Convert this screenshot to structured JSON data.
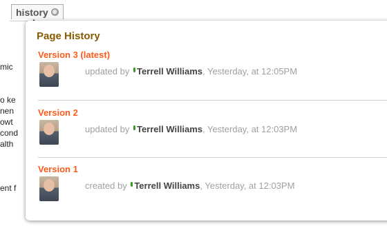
{
  "tab": {
    "label": "history",
    "close_glyph": "⊗"
  },
  "background_fragments": [
    "mic",
    "o ke",
    "nen",
    "owt",
    "cond",
    "alth",
    "ent f"
  ],
  "popup": {
    "title": "Page History",
    "versions": [
      {
        "label": "Version 3 (latest)",
        "action": "updated by",
        "user": "Terrell Williams",
        "time": ", Yesterday, at 12:05PM"
      },
      {
        "label": "Version 2",
        "action": "updated by",
        "user": "Terrell Williams",
        "time": ", Yesterday, at 12:03PM"
      },
      {
        "label": "Version 1",
        "action": "created by",
        "user": "Terrell Williams",
        "time": ", Yesterday, at 12:03PM"
      }
    ]
  },
  "colors": {
    "title": "#8a5a00",
    "version_label": "#ff5a1a",
    "meta_text": "#a0a0a0",
    "user_text": "#444444",
    "user_dot": "#3a9a2a"
  },
  "icons": {
    "tab_close": "close-circle-icon",
    "tab_caret": "caret-up-icon",
    "user_presence": "presence-dot-icon"
  }
}
